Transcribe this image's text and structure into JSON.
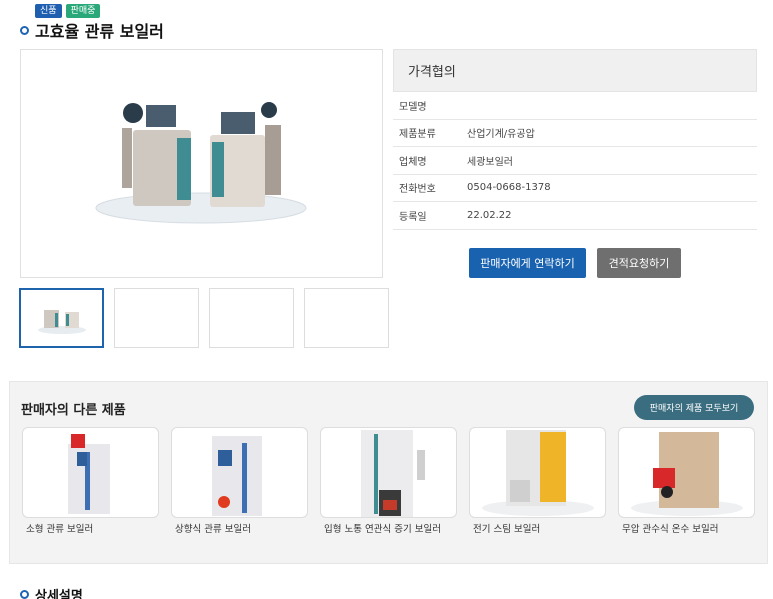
{
  "badges": {
    "new": "신품",
    "sale": "판매중"
  },
  "product": {
    "title": "고효율 관류 보일러",
    "price": "가격협의",
    "specs": [
      {
        "label": "모델명",
        "value": ""
      },
      {
        "label": "제품분류",
        "value": "산업기계/유공압"
      },
      {
        "label": "업체명",
        "value": "세광보일러"
      },
      {
        "label": "전화번호",
        "value": "0504-0668-1378"
      },
      {
        "label": "등록일",
        "value": "22.02.22"
      }
    ]
  },
  "actions": {
    "contact_label": "판매자에게 연락하기",
    "quote_label": "견적요청하기"
  },
  "others": {
    "title": "판매자의 다른 제품",
    "view_all_label": "판매자의 제품 모두보기",
    "items": [
      {
        "name": "소형 관류 보일러"
      },
      {
        "name": "상향식 관류 보일러"
      },
      {
        "name": "입형 노통 연관식 증기 보일러"
      },
      {
        "name": "전기 스팀 보일러"
      },
      {
        "name": "무압 관수식 온수 보일러"
      }
    ]
  },
  "detail": {
    "title": "상세설명"
  },
  "colors": {
    "primary": "#1962b0",
    "secondary": "#6f6f6f",
    "view_all": "#3a6d7f",
    "badge_new": "#1f5fb0",
    "badge_sale": "#2aa87a"
  }
}
